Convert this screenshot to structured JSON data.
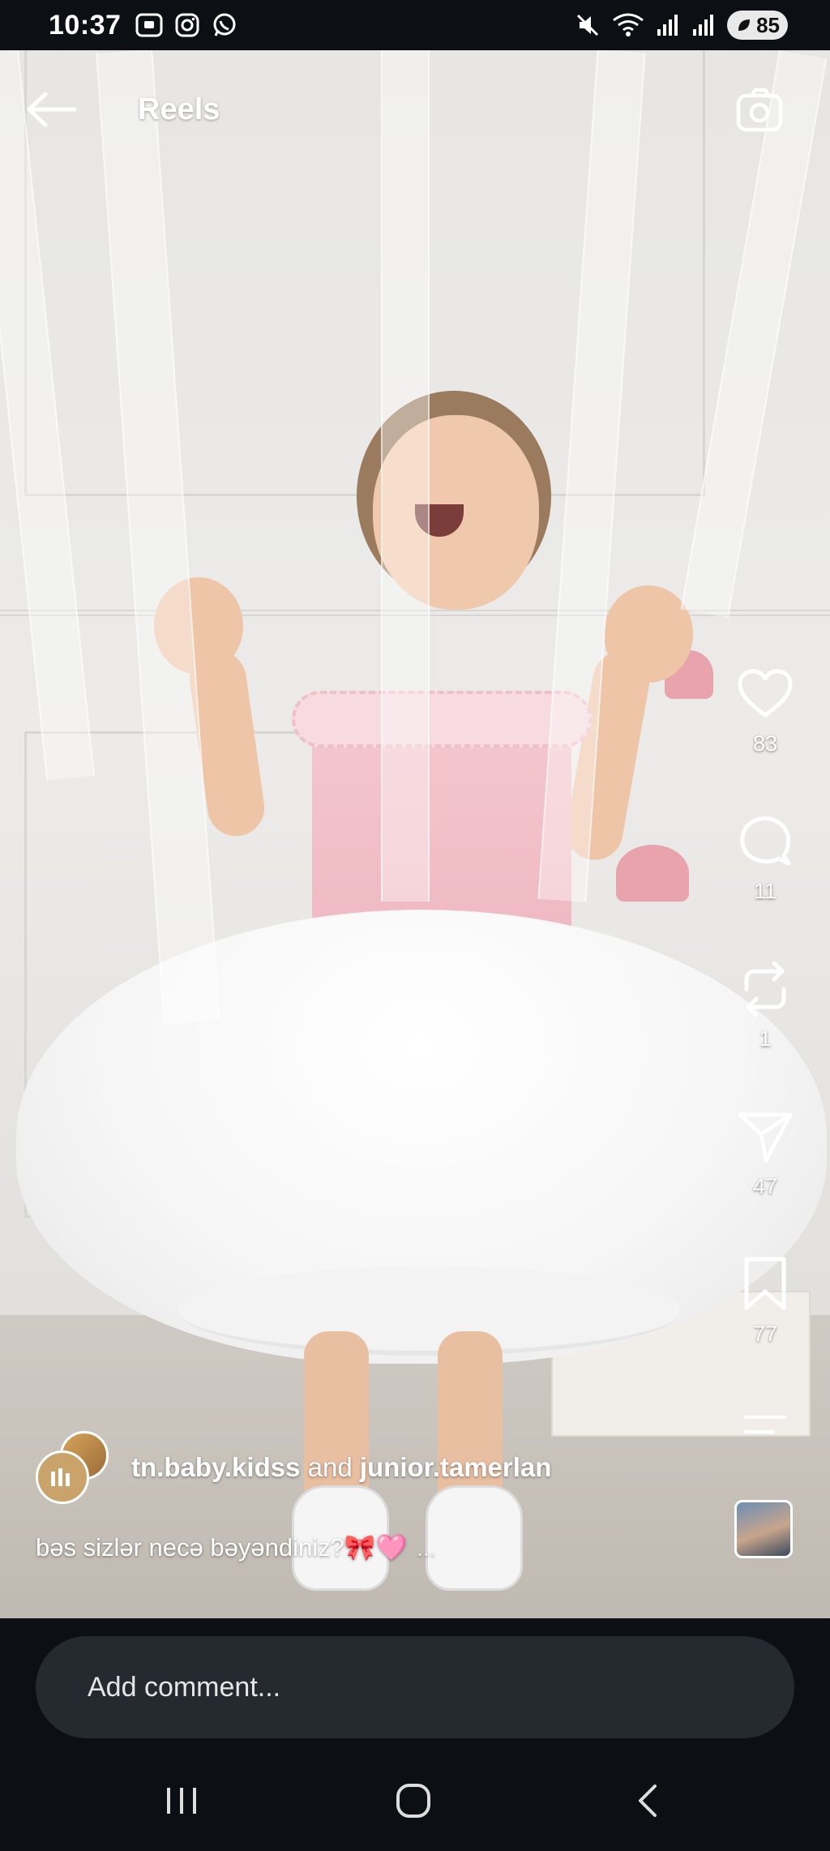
{
  "status_bar": {
    "time": "10:37",
    "left_icons": [
      "screenshot-icon",
      "instagram-icon",
      "whatsapp-icon"
    ],
    "right_icons": [
      "mute-icon",
      "wifi-icon",
      "signal-icon",
      "signal-icon"
    ],
    "battery": "85"
  },
  "header": {
    "title": "Reels"
  },
  "actions": {
    "likes": "83",
    "comments": "11",
    "reposts": "1",
    "shares": "47",
    "saves": "77"
  },
  "post": {
    "author_primary": "tn.baby.kidss",
    "connector": "and",
    "author_secondary": "junior.tamerlan",
    "caption": "bəs sizlər necə bəyəndiniz?",
    "caption_emoji": "🎀🩷",
    "caption_more": "..."
  },
  "comment": {
    "placeholder": "Add comment..."
  },
  "colors": {
    "background": "#0c0f14",
    "input_bg": "#252a31",
    "text": "#ffffff"
  }
}
